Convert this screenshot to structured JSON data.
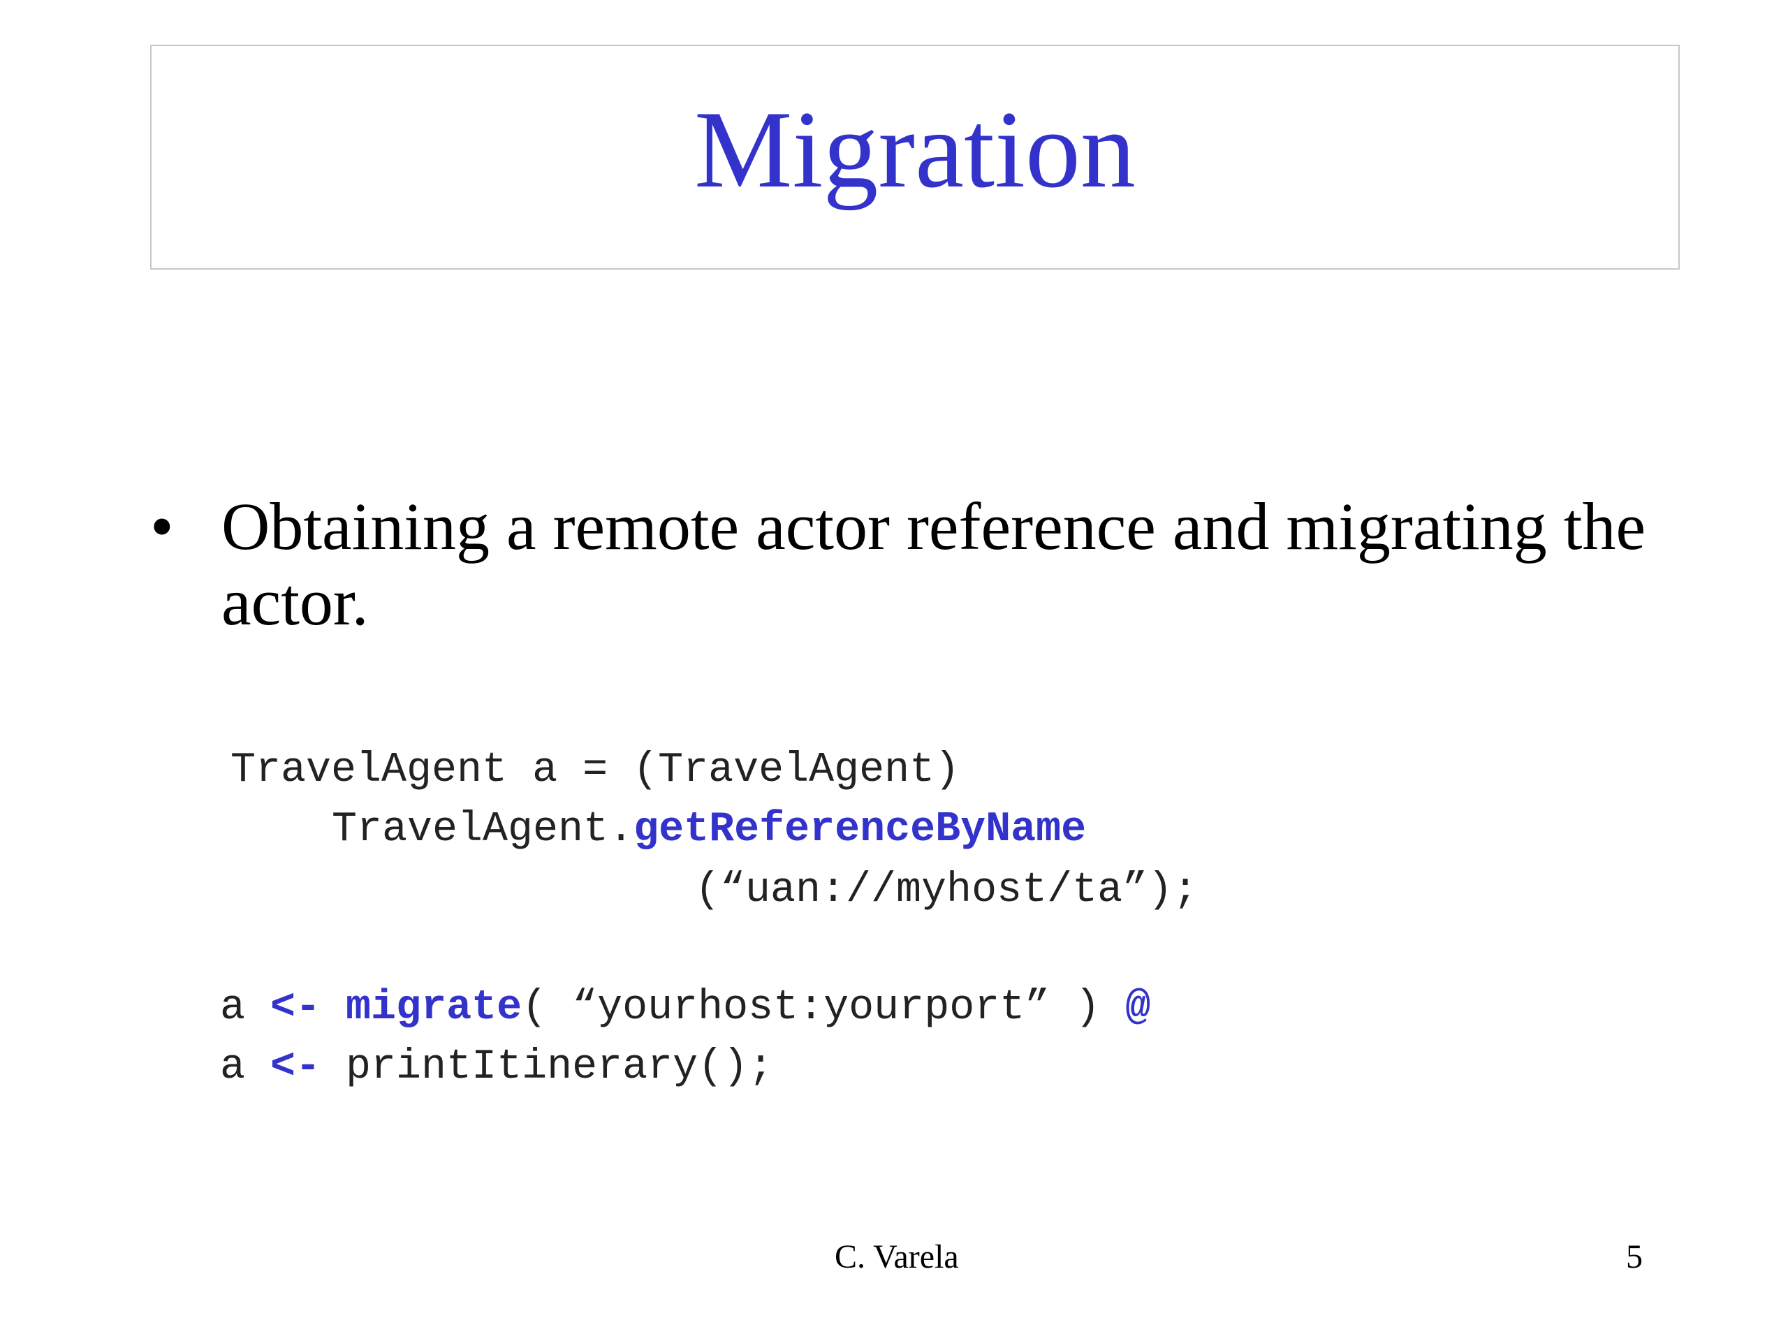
{
  "slide": {
    "title": "Migration",
    "bullet": {
      "symbol": "•",
      "text": "Obtaining a remote actor reference and migrating the actor."
    },
    "code": {
      "line1": "TravelAgent a = (TravelAgent)",
      "line2_prefix": "TravelAgent.",
      "line2_method": "getReferenceByName",
      "line3": "(“uan://myhost/ta”);",
      "line4": {
        "var": "a ",
        "op": "<-",
        "space": " ",
        "method": "migrate",
        "args": "( “yourhost:yourport” ) ",
        "join": "@"
      },
      "line5": {
        "var": "a ",
        "op": "<-",
        "rest": " printItinerary();"
      }
    },
    "footer": {
      "author": "C. Varela",
      "page_number": "5"
    },
    "colors": {
      "accent": "#3333cc",
      "text": "#000000",
      "code_text": "#222222",
      "title_border": "#c8c8c8"
    }
  }
}
